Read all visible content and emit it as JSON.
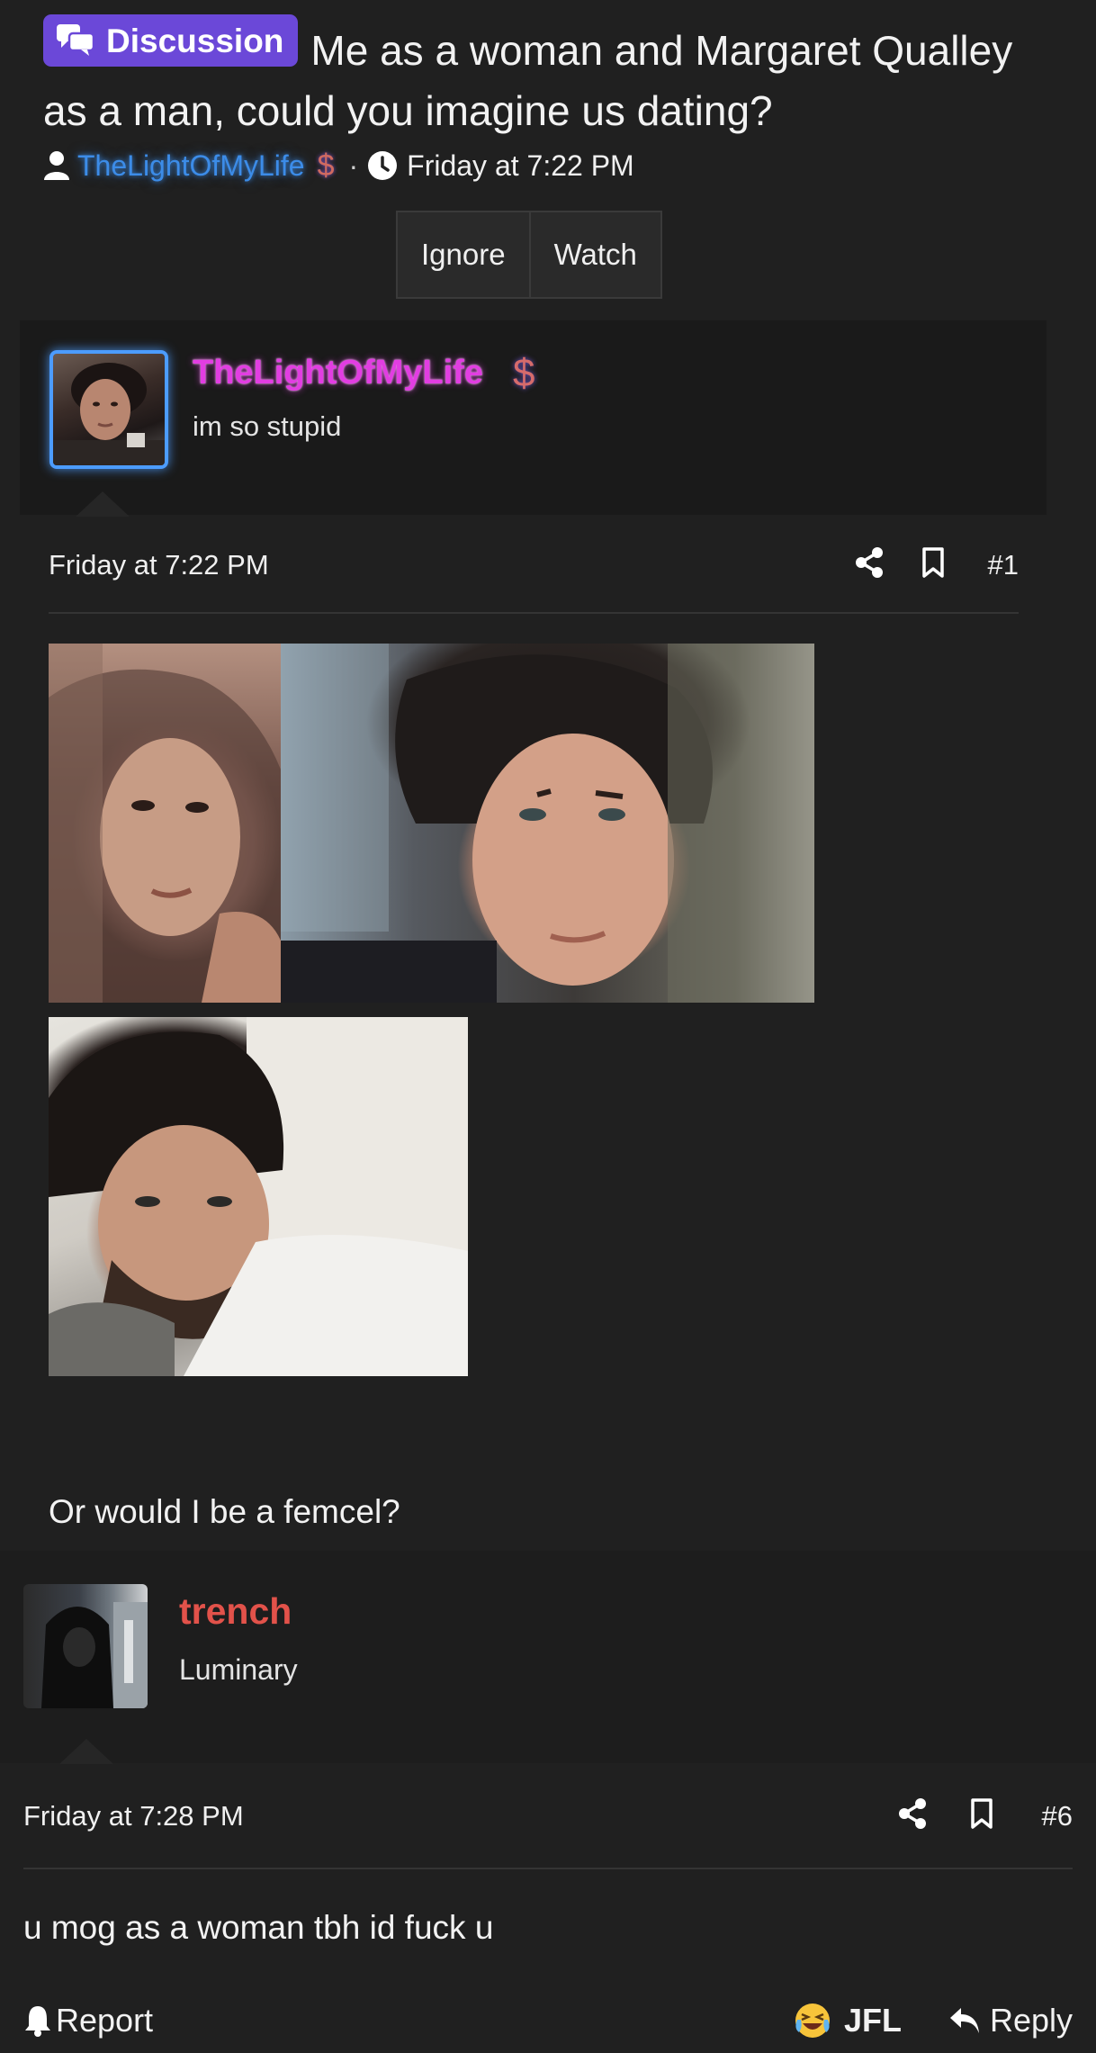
{
  "thread": {
    "prefix_label": "Discussion",
    "title": "Me as a woman and Margaret Qualley as a man, could you imagine us dating?",
    "author": "TheLightOfMyLife",
    "author_badge": "$",
    "separator": "·",
    "date": "Friday at 7:22 PM"
  },
  "actions": {
    "ignore": "Ignore",
    "watch": "Watch"
  },
  "post1": {
    "username": "TheLightOfMyLife",
    "badge": "$",
    "user_title": "im so stupid",
    "date": "Friday at 7:22 PM",
    "number": "#1",
    "body_text": "Or would I be a femcel?"
  },
  "post2": {
    "username": "trench",
    "user_title": "Luminary",
    "date": "Friday at 7:28 PM",
    "number": "#6",
    "body_text": "u mog as a woman tbh id fuck u"
  },
  "footer": {
    "report": "Report",
    "reaction": "JFL",
    "reply": "Reply"
  },
  "colors": {
    "background": "#202020",
    "badge_purple": "#6b48d8",
    "author_blue": "#3c8ce8",
    "op_magenta": "#e23de2",
    "trench_red": "#e2524a"
  },
  "icons": [
    "comments-icon",
    "user-icon",
    "clock-icon",
    "share-icon",
    "bookmark-icon",
    "bell-icon",
    "laughing-crying-emoji-icon",
    "reply-arrow-icon"
  ]
}
